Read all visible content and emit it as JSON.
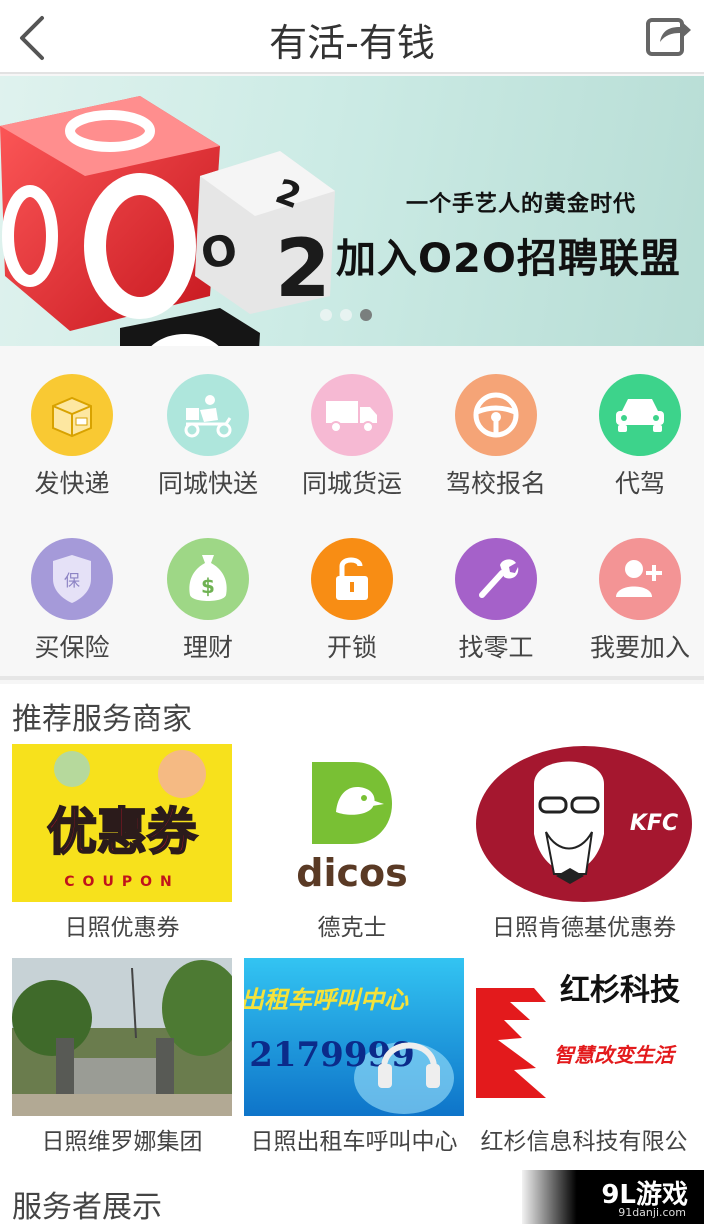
{
  "header": {
    "title": "有活-有钱",
    "back_icon": "chevron-left-icon",
    "share_icon": "share-icon"
  },
  "banner": {
    "tagline": "一个手艺人的黄金时代",
    "headline": "加入O2O招聘联盟",
    "dice_text": "O2O",
    "active_dot": 3,
    "dot_count": 3
  },
  "services": [
    {
      "label": "发快递",
      "icon": "package-icon",
      "color": "#f9c933"
    },
    {
      "label": "同城快送",
      "icon": "courier-scooter-icon",
      "color": "#aee6dc"
    },
    {
      "label": "同城货运",
      "icon": "truck-icon",
      "color": "#f6b9d3"
    },
    {
      "label": "驾校报名",
      "icon": "steering-wheel-icon",
      "color": "#f5a477"
    },
    {
      "label": "代驾",
      "icon": "car-icon",
      "color": "#3dd38b"
    },
    {
      "label": "买保险",
      "icon": "insurance-shield-icon",
      "color": "#a59ad9"
    },
    {
      "label": "理财",
      "icon": "money-bag-icon",
      "color": "#9ed786"
    },
    {
      "label": "开锁",
      "icon": "unlock-icon",
      "color": "#f88d14"
    },
    {
      "label": "找零工",
      "icon": "wrench-icon",
      "color": "#a561c9"
    },
    {
      "label": "我要加入",
      "icon": "add-user-icon",
      "color": "#f39495"
    }
  ],
  "merchants_section": {
    "title": "推荐服务商家",
    "items": [
      {
        "label": "日照优惠券",
        "logo_text": "优惠券",
        "logo_sub": "COUPON"
      },
      {
        "label": "德克士",
        "logo_text": "dicos"
      },
      {
        "label": "日照肯德基优惠券",
        "logo_text": "KFC"
      },
      {
        "label": "日照维罗娜集团"
      },
      {
        "label": "日照出租车呼叫中心",
        "logo_text": "出租车呼叫中心",
        "logo_sub": "2179999"
      },
      {
        "label": "红杉信息科技有限公",
        "logo_text": "红杉科技",
        "logo_sub": "智慧改变生活"
      }
    ]
  },
  "providers_section": {
    "title": "服务者展示"
  },
  "watermark": {
    "text": "9L游戏",
    "sub": "91danji.com"
  }
}
